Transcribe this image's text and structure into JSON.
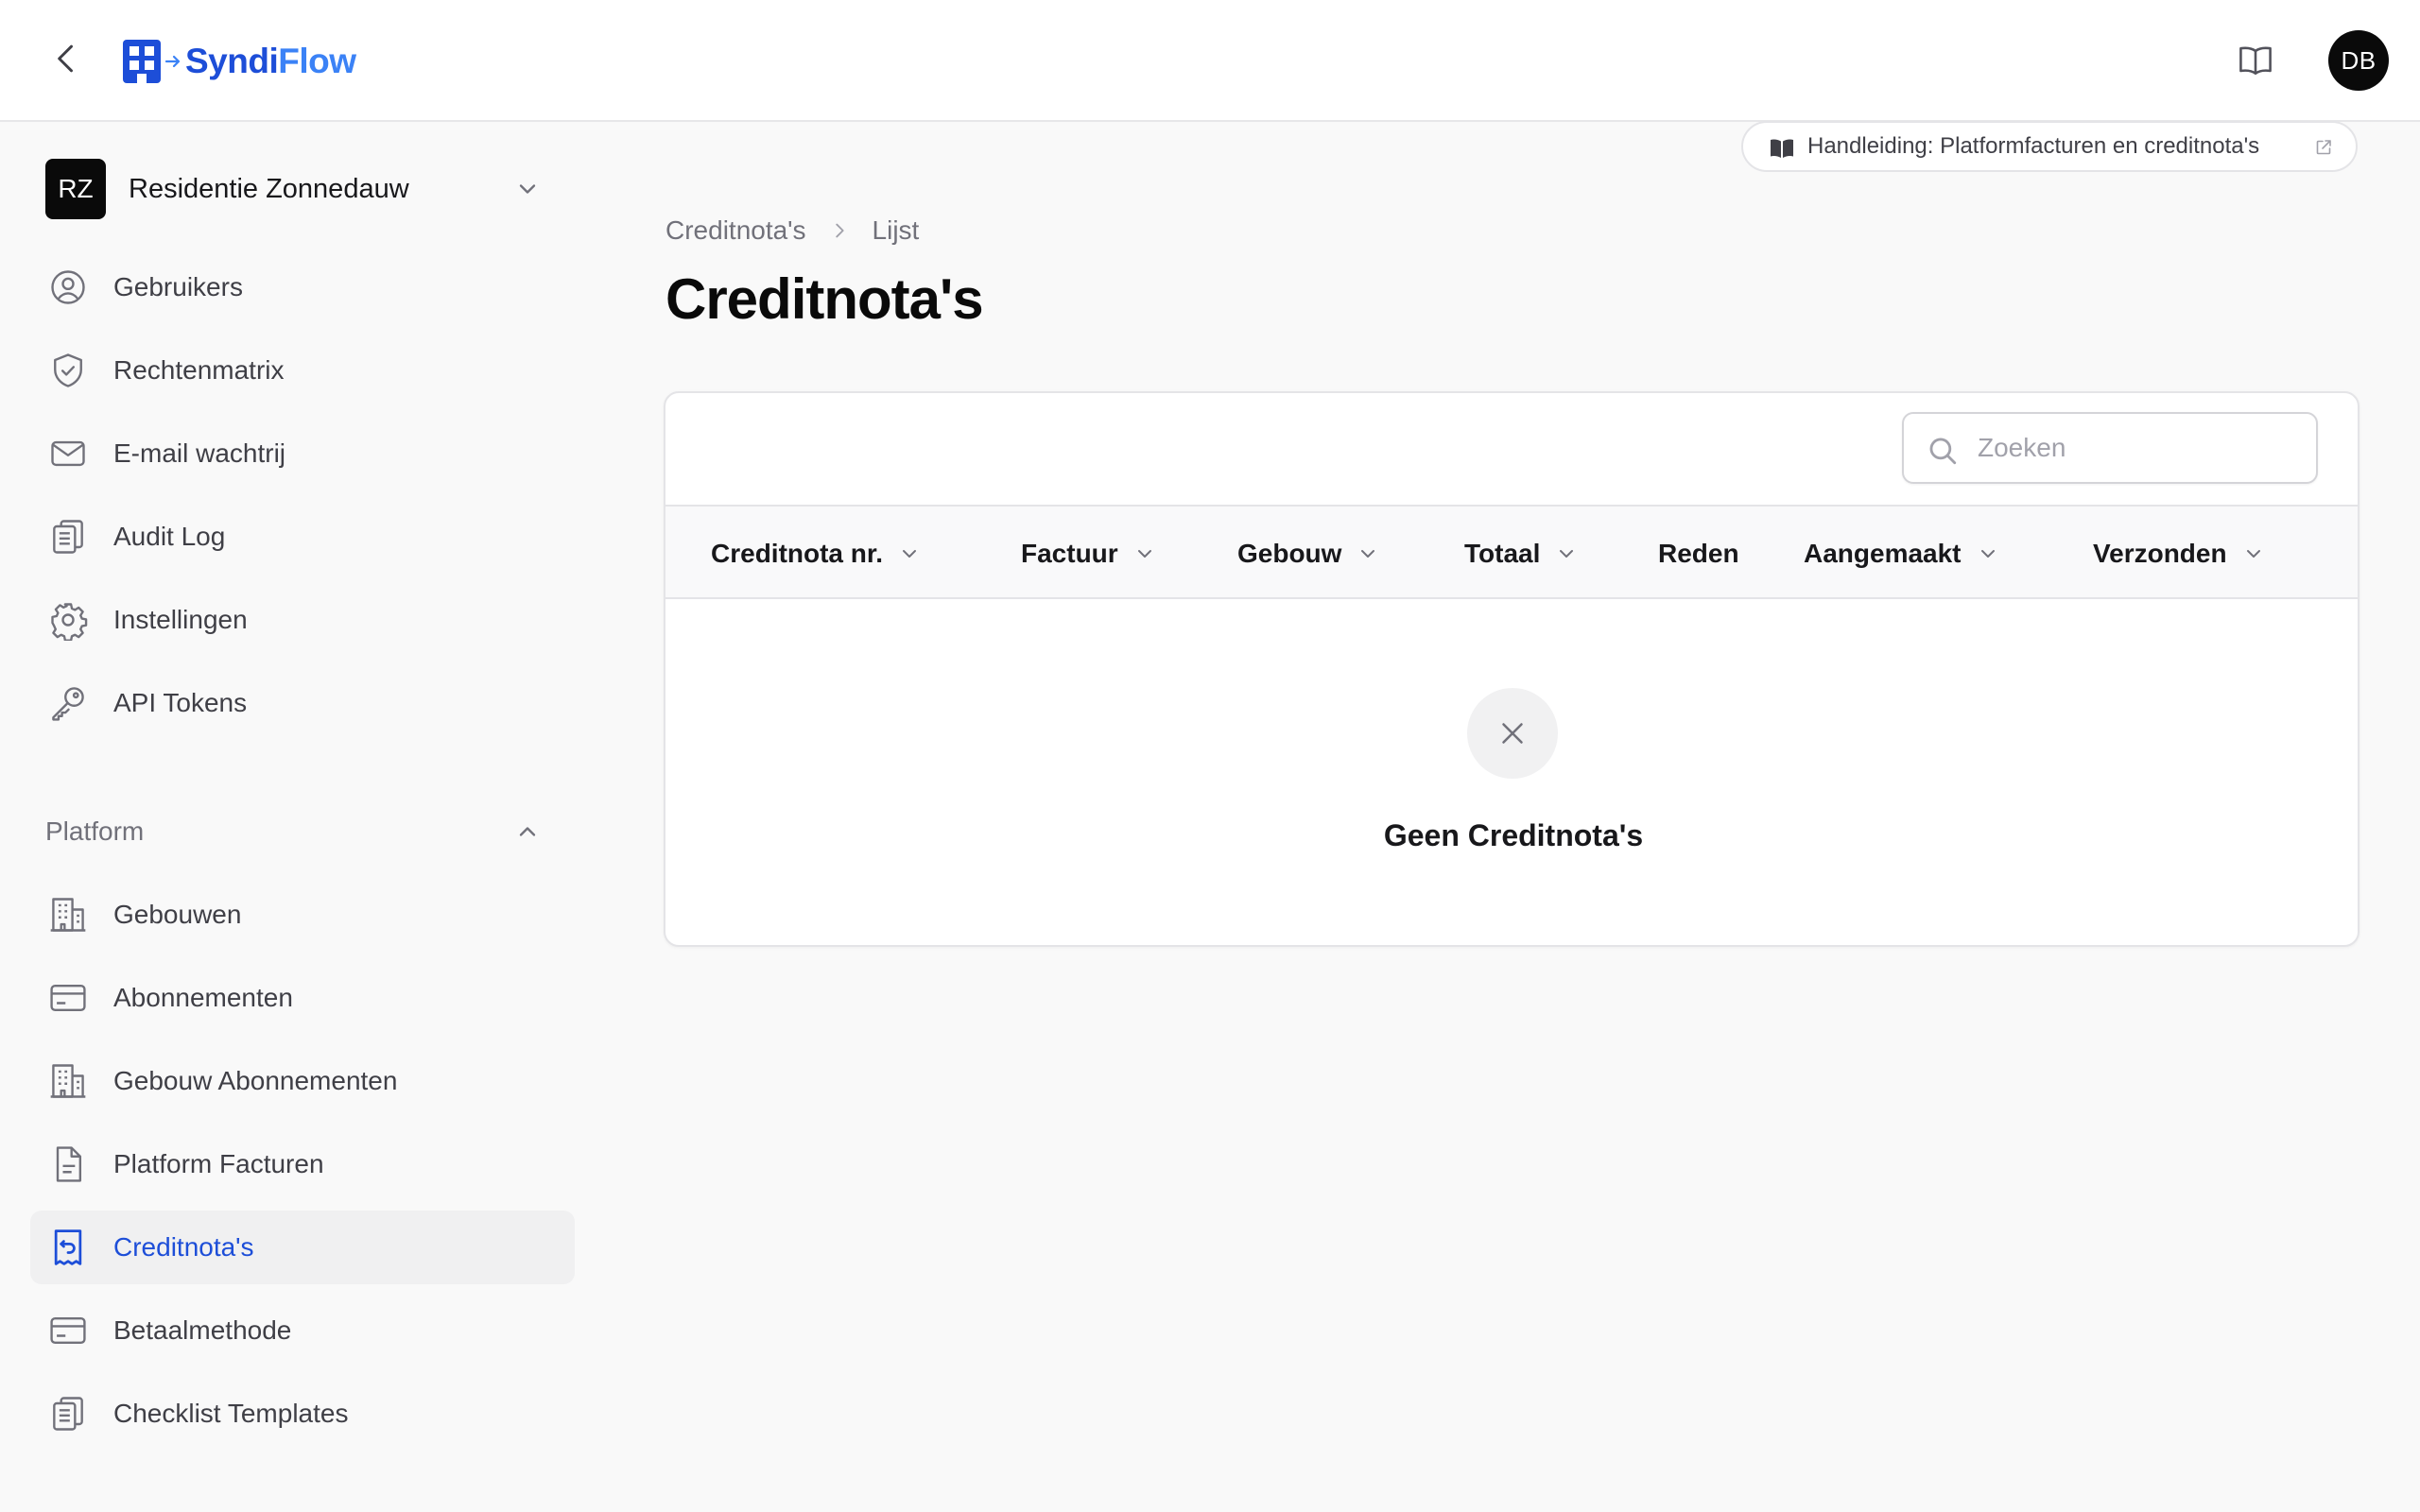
{
  "app": {
    "name_part1": "Syndi",
    "name_part2": "Flow",
    "user_initials": "DB",
    "brand_color": "#1d4ed8"
  },
  "tenant": {
    "initials": "RZ",
    "name": "Residentie Zonnedauw"
  },
  "sidebar": {
    "items": [
      {
        "label": "Gebruikers",
        "icon": "user-circle-icon"
      },
      {
        "label": "Rechtenmatrix",
        "icon": "shield-check-icon"
      },
      {
        "label": "E-mail wachtrij",
        "icon": "envelope-icon"
      },
      {
        "label": "Audit Log",
        "icon": "clipboard-list-icon"
      },
      {
        "label": "Instellingen",
        "icon": "gear-icon"
      },
      {
        "label": "API Tokens",
        "icon": "key-icon"
      }
    ],
    "section_label": "Platform",
    "platform_items": [
      {
        "label": "Gebouwen",
        "icon": "building-icon"
      },
      {
        "label": "Abonnementen",
        "icon": "credit-card-icon"
      },
      {
        "label": "Gebouw Abonnementen",
        "icon": "building-icon"
      },
      {
        "label": "Platform Facturen",
        "icon": "document-icon"
      },
      {
        "label": "Creditnota's",
        "icon": "receipt-refund-icon",
        "active": true
      },
      {
        "label": "Betaalmethode",
        "icon": "credit-card-icon"
      },
      {
        "label": "Checklist Templates",
        "icon": "clipboard-list-icon"
      }
    ]
  },
  "manual_link": {
    "label": "Handleiding: Platformfacturen en creditnota's"
  },
  "breadcrumb": [
    "Creditnota's",
    "Lijst"
  ],
  "page_title": "Creditnota's",
  "search": {
    "placeholder": "Zoeken",
    "value": ""
  },
  "table": {
    "columns": [
      {
        "label": "Creditnota nr.",
        "sortable": true
      },
      {
        "label": "Factuur",
        "sortable": true
      },
      {
        "label": "Gebouw",
        "sortable": true
      },
      {
        "label": "Totaal",
        "sortable": true
      },
      {
        "label": "Reden",
        "sortable": false
      },
      {
        "label": "Aangemaakt",
        "sortable": true
      },
      {
        "label": "Verzonden",
        "sortable": true
      }
    ],
    "rows": [],
    "empty_message": "Geen Creditnota's"
  }
}
